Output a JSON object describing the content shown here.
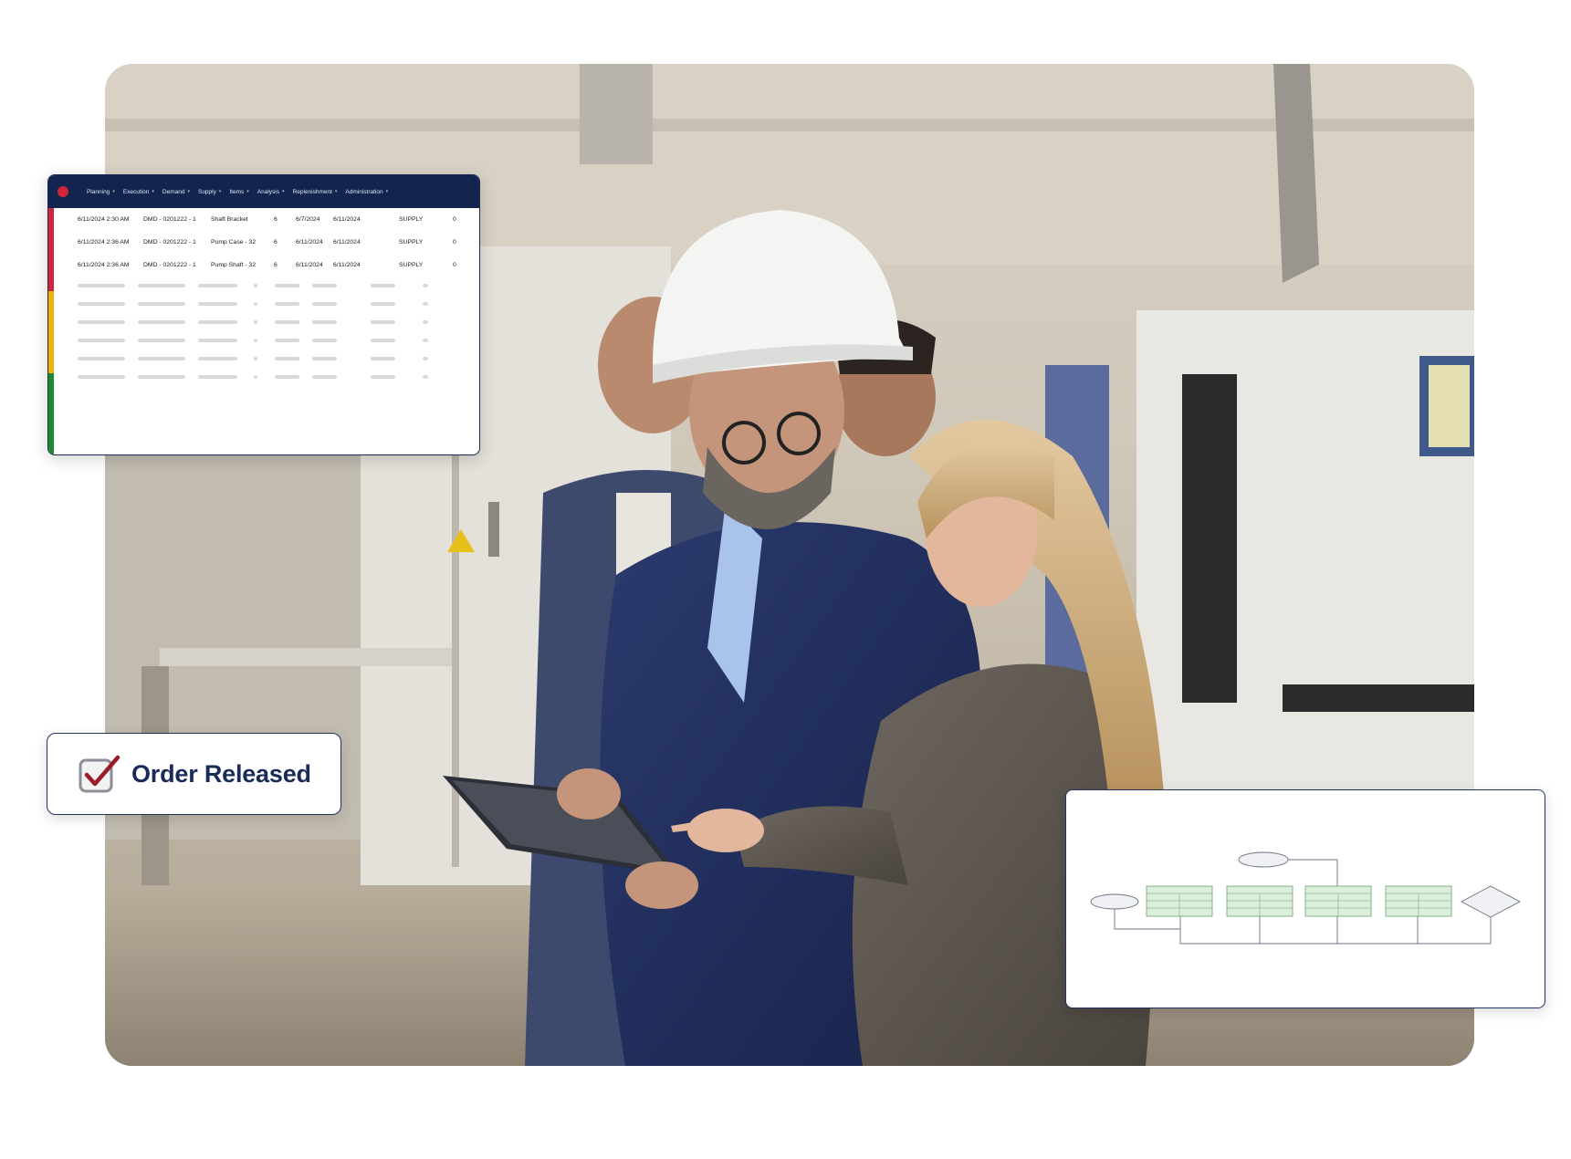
{
  "schedule_table": {
    "nav": [
      {
        "label": "Planning"
      },
      {
        "label": "Execution"
      },
      {
        "label": "Demand"
      },
      {
        "label": "Supply"
      },
      {
        "label": "Items"
      },
      {
        "label": "Analysis"
      },
      {
        "label": "Replenishment"
      },
      {
        "label": "Administration"
      }
    ],
    "status_colors": [
      "#d0263a",
      "#f0b400",
      "#1e8a2e"
    ],
    "rows": [
      {
        "time": "6/11/2024 2:30 AM",
        "id": "DMD - 0201222 - 1",
        "item": "Shaft Bracket",
        "qty": "6",
        "date1": "6/7/2024",
        "date2": "6/11/2024",
        "type": "SUPPLY",
        "count": "0"
      },
      {
        "time": "6/11/2024 2:36 AM",
        "id": "DMD - 0201222 - 1",
        "item": "Pump Case - 32",
        "qty": "6",
        "date1": "6/11/2024",
        "date2": "6/11/2024",
        "type": "SUPPLY",
        "count": "0"
      },
      {
        "time": "6/11/2024 2:36 AM",
        "id": "DMD - 0201222 - 1",
        "item": "Pump Shaft - 32",
        "qty": "6",
        "date1": "6/11/2024",
        "date2": "6/11/2024",
        "type": "SUPPLY",
        "count": "0"
      }
    ]
  },
  "order_badge": {
    "label": "Order Released",
    "check_icon": "checkbox-check-icon",
    "accent": "#9b1b2a"
  },
  "flow_diagram": {
    "box_fill": "#dcefdc",
    "box_stroke": "#6aa36f"
  }
}
